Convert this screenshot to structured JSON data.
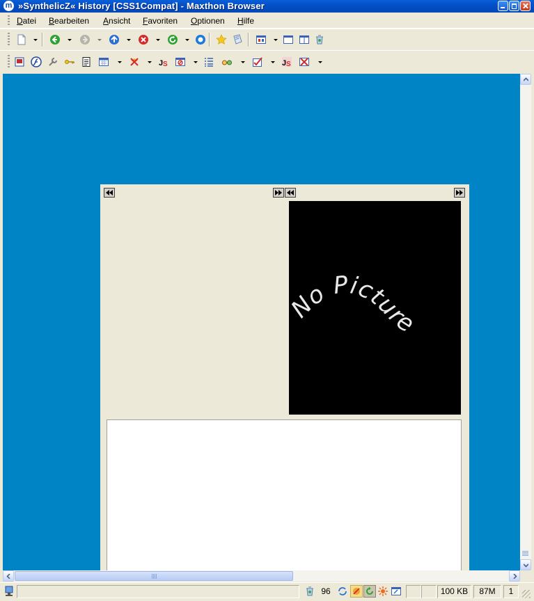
{
  "window": {
    "title": "»SynthelicZ« History [CSS1Compat] - Maxthon Browser",
    "app_icon_letter": "m"
  },
  "menu": [
    {
      "underline": "D",
      "rest": "atei"
    },
    {
      "underline": "B",
      "rest": "earbeiten"
    },
    {
      "underline": "A",
      "rest": "nsicht"
    },
    {
      "underline": "F",
      "rest": "avoriten"
    },
    {
      "underline": "O",
      "rest": "ptionen"
    },
    {
      "underline": "H",
      "rest": "ilfe"
    }
  ],
  "toolbar_main": [
    "new-page-icon",
    "back-icon",
    "forward-icon",
    "home-icon",
    "stop-icon",
    "refresh-icon",
    "go-icon",
    "favorites-star-icon",
    "collections-icon",
    "tile-windows-icon",
    "fullscreen-icon",
    "split-view-icon",
    "recycle-icon"
  ],
  "toolbar_plugins": [
    "screenshot-icon",
    "flash-icon",
    "wrench-icon",
    "key-icon",
    "notepad-icon",
    "calendar-icon",
    "block-ads-icon",
    "javascript-icon",
    "popup-block-icon",
    "list-icon",
    "glasses-icon",
    "check-icon",
    "javascript-off-icon",
    "cross-icon"
  ],
  "content": {
    "background_color": "#0084c6",
    "picture_placeholder_text": "No Picture",
    "nav_buttons": {
      "rewind": "◀◀",
      "forward": "▶▶"
    }
  },
  "status": {
    "ad_blocked_count": "96",
    "page_size": "100 KB",
    "memory": "87M",
    "page_count": "1"
  },
  "colors": {
    "titlebar": "#0350c8",
    "chrome": "#ece9d8",
    "accent": "#0084c6"
  }
}
